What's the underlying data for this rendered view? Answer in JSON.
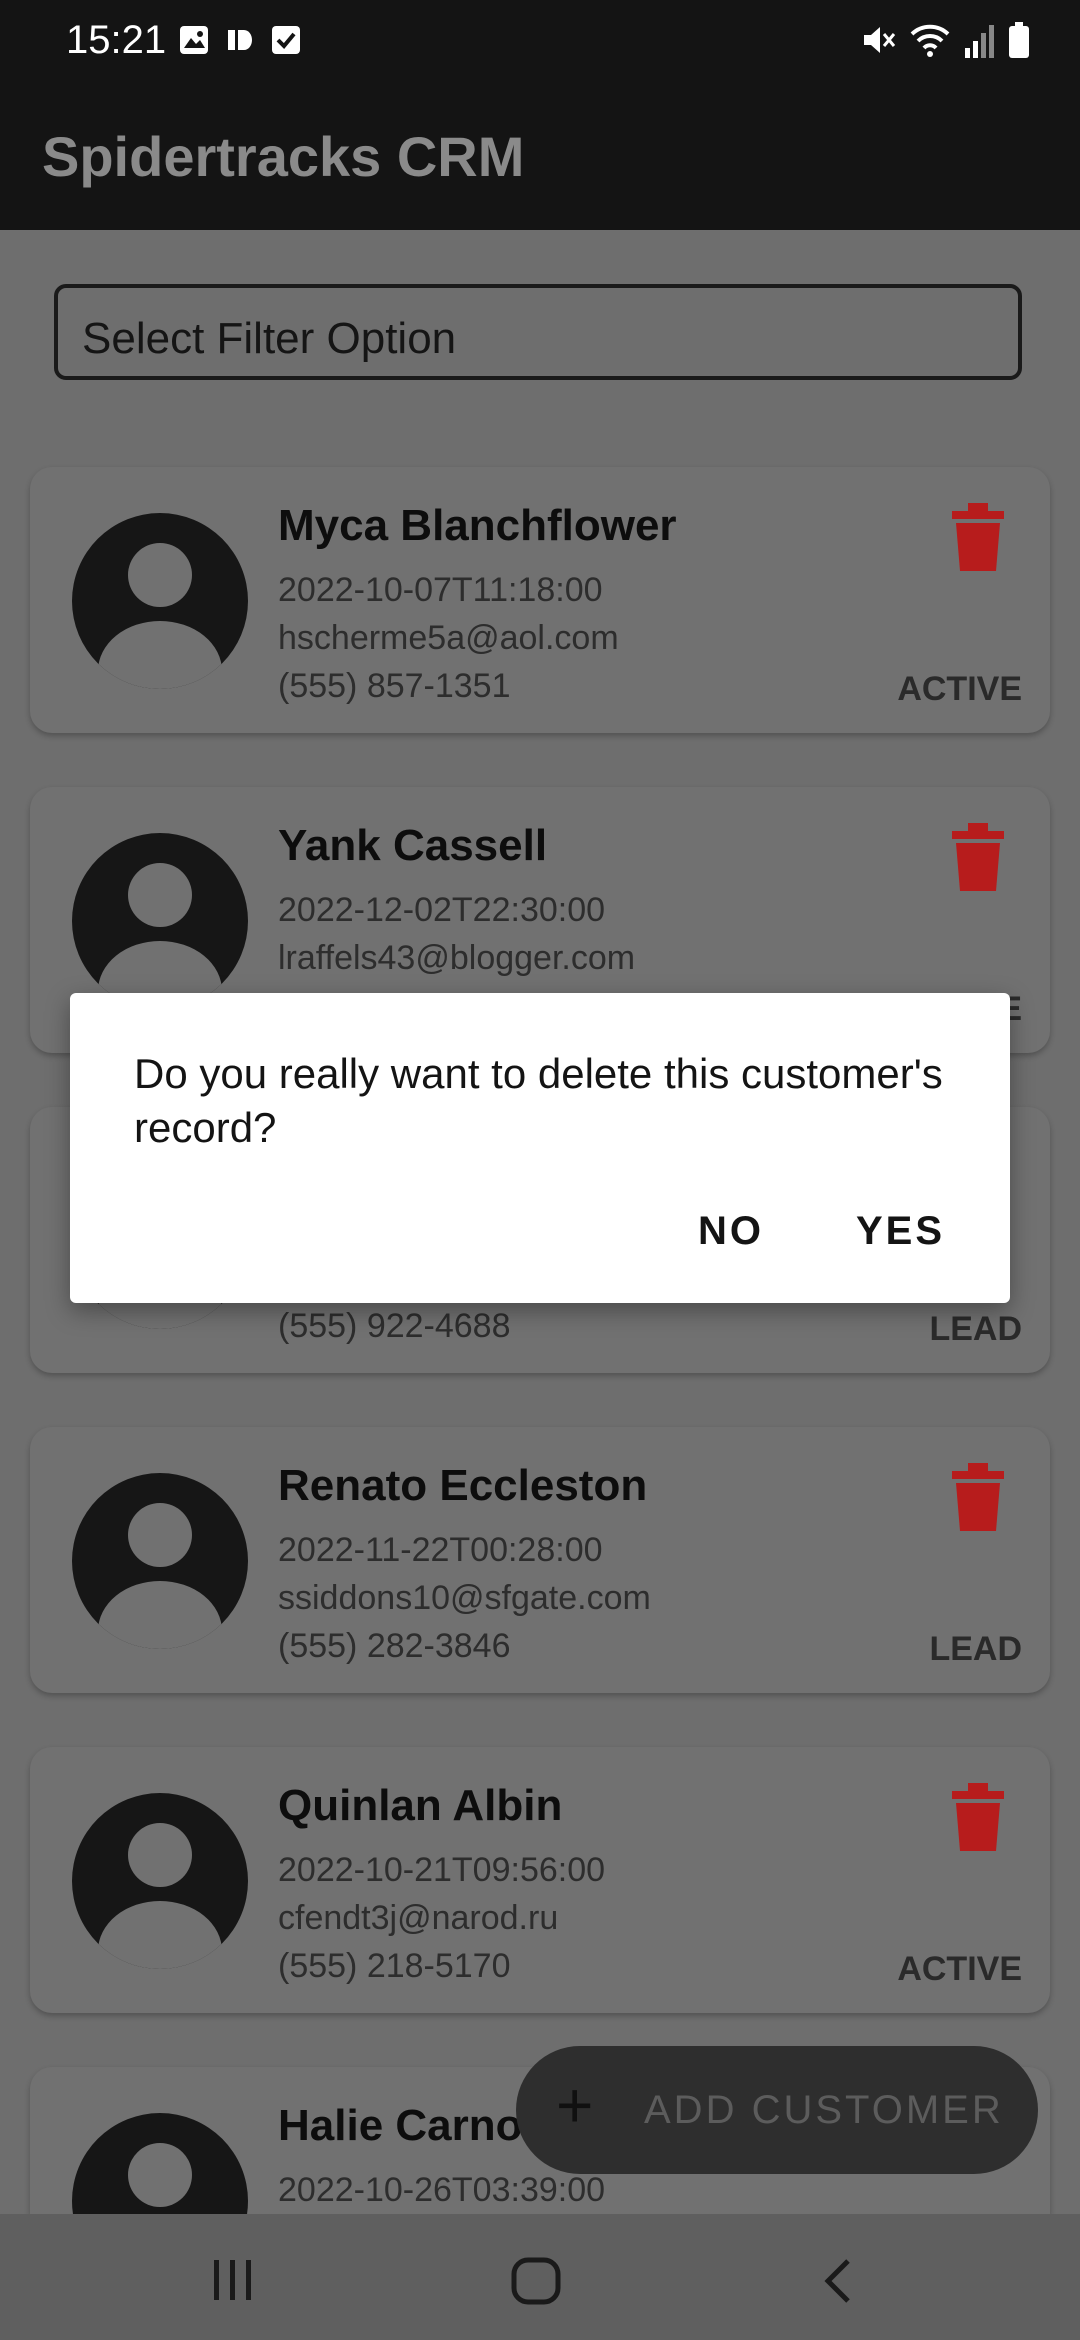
{
  "status_bar": {
    "time": "15:21",
    "left_icons": [
      "image-icon",
      "sms-icon",
      "checkbox-icon"
    ],
    "right_icons": [
      "mute-icon",
      "wifi-icon",
      "signal-icon",
      "battery-icon"
    ]
  },
  "app": {
    "title": "Spidertracks CRM"
  },
  "filter": {
    "placeholder": "Select Filter Option"
  },
  "customers": [
    {
      "name": "Myca Blanchflower",
      "date": "2022-10-07T11:18:00",
      "email": "hscherme5a@aol.com",
      "phone": "(555) 857-1351",
      "status": "ACTIVE"
    },
    {
      "name": "Yank Cassell",
      "date": "2022-12-02T22:30:00",
      "email": "lraffels43@blogger.com",
      "phone": "",
      "status": "E"
    },
    {
      "name": "",
      "date": "",
      "email": "",
      "phone": "(555) 922-4688",
      "status": "LEAD"
    },
    {
      "name": "Renato Eccleston",
      "date": "2022-11-22T00:28:00",
      "email": "ssiddons10@sfgate.com",
      "phone": "(555) 282-3846",
      "status": "LEAD"
    },
    {
      "name": "Quinlan Albin",
      "date": "2022-10-21T09:56:00",
      "email": "cfendt3j@narod.ru",
      "phone": "(555) 218-5170",
      "status": "ACTIVE"
    },
    {
      "name": "Halie Carno",
      "date": "2022-10-26T03:39:00",
      "email": "",
      "phone": "",
      "status": ""
    }
  ],
  "fab": {
    "icon": "plus-icon",
    "label": "ADD CUSTOMER"
  },
  "dialog": {
    "message": "Do you really want to delete this customer's record?",
    "no_label": "NO",
    "yes_label": "YES"
  },
  "nav": {
    "icons": [
      "recents-icon",
      "home-icon",
      "back-icon"
    ]
  },
  "colors": {
    "delete": "#b71c1c",
    "app_bar": "#141414",
    "scrim_bg": "#6e6e6e"
  }
}
